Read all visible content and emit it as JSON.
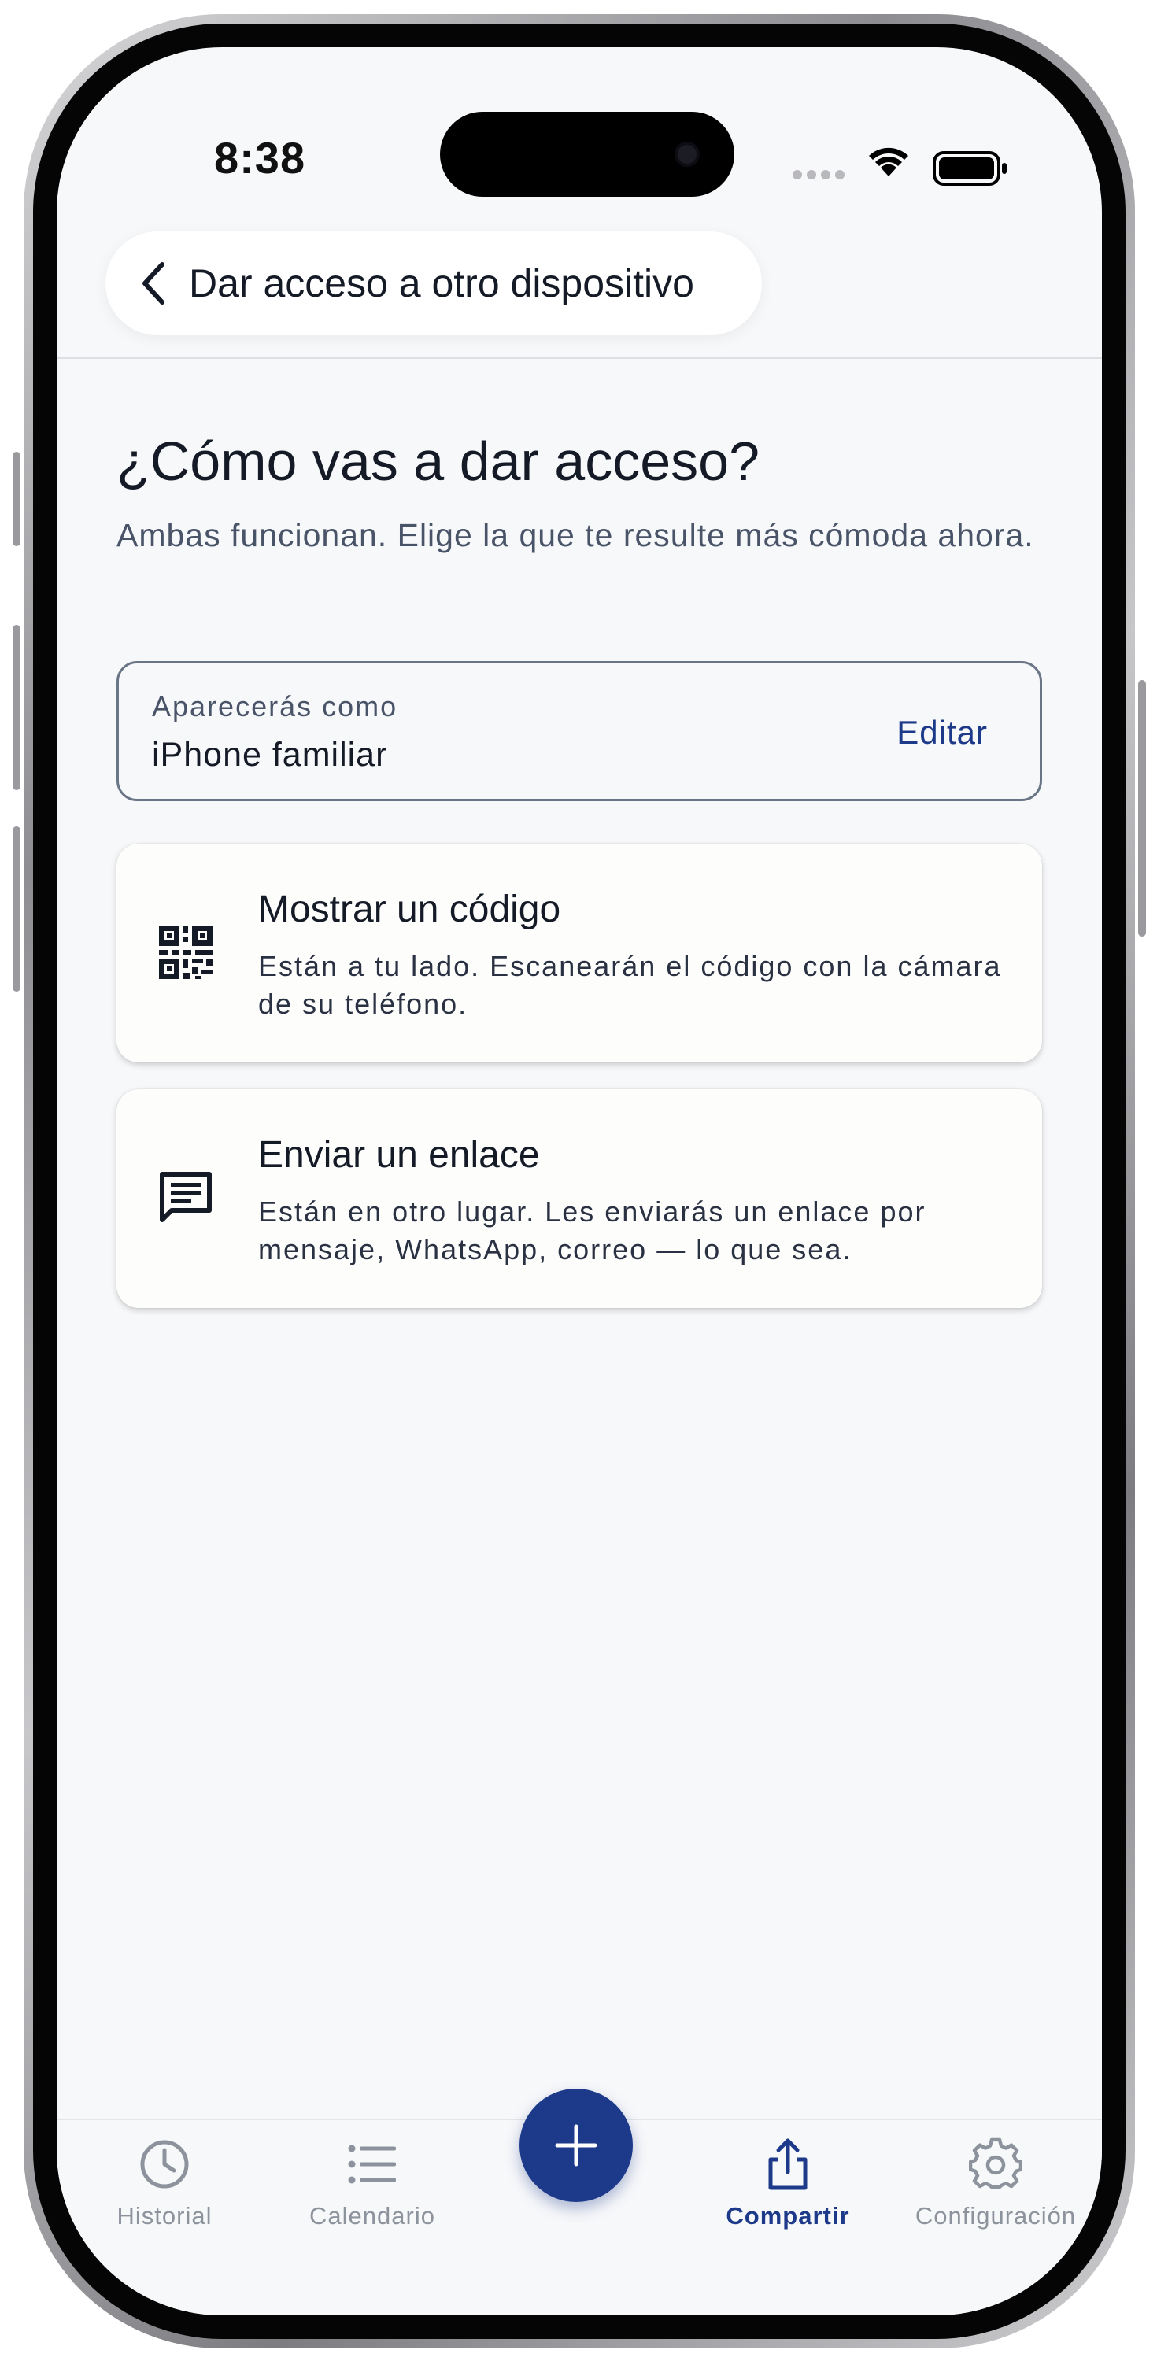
{
  "status_bar": {
    "time": "8:38"
  },
  "header": {
    "back_icon": "chevron-left-icon",
    "title": "Dar acceso a otro dispositivo"
  },
  "main": {
    "heading": "¿Cómo vas a dar acceso?",
    "subtext": "Ambas funcionan. Elige la que te resulte más cómoda ahora.",
    "name_field": {
      "label": "Aparecerás como",
      "value": "iPhone familiar",
      "edit_label": "Editar"
    },
    "options": [
      {
        "icon": "qr-code-icon",
        "title": "Mostrar un código",
        "description": "Están a tu lado. Escanearán el código con la cámara de su teléfono."
      },
      {
        "icon": "message-icon",
        "title": "Enviar un enlace",
        "description": "Están en otro lugar. Les enviarás un enlace por mensaje, WhatsApp, correo — lo que sea."
      }
    ]
  },
  "tabbar": {
    "items": [
      {
        "label": "Historial",
        "icon": "clock-icon",
        "active": false
      },
      {
        "label": "Calendario",
        "icon": "list-icon",
        "active": false
      },
      {
        "label": "Compartir",
        "icon": "share-icon",
        "active": true
      },
      {
        "label": "Configuración",
        "icon": "gear-icon",
        "active": false
      }
    ],
    "fab_icon": "plus-icon"
  },
  "colors": {
    "accent": "#1d3a8a",
    "background": "#f7f8fa",
    "text_primary": "#141a26",
    "text_secondary": "#4a5468",
    "tab_inactive": "#8d939c"
  }
}
